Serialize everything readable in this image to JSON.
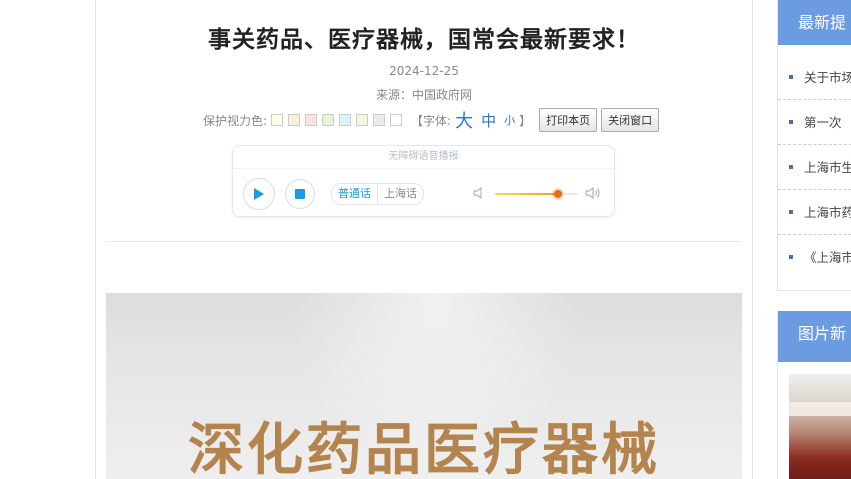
{
  "article": {
    "title": "事关药品、医疗器械，国常会最新要求！",
    "date": "2024-12-25",
    "source": "来源：中国政府网"
  },
  "toolbar": {
    "eye_label": "保护视力色:",
    "swatches": [
      "#fdfde8",
      "#feeedd",
      "#fde2e2",
      "#e9f6dc",
      "#dcf4fb",
      "#f1f9e0",
      "#ececec",
      "#ffffff"
    ],
    "font_label": "【字体:",
    "font_big": "大",
    "font_mid": "中",
    "font_small": "小",
    "font_close": "】",
    "print_label": "打印本页",
    "close_label": "关闭窗口"
  },
  "player": {
    "header": "无障碍语音播报",
    "lang_mandarin": "普通话",
    "lang_shanghai": "上海话",
    "volume_level": 0.76,
    "accent": "#1a9be0"
  },
  "hero": {
    "text": "深化药品医疗器械"
  },
  "sidebar": {
    "latest_title": "最新提",
    "latest_items": [
      "关于市场",
      "第一次",
      "上海市生",
      "上海市药",
      "《上海市"
    ],
    "pics_title": "图片新"
  },
  "colors": {
    "panel_header": "#6b9be0",
    "link_blue": "#2b78c5",
    "hero_text": "#b4844e"
  }
}
